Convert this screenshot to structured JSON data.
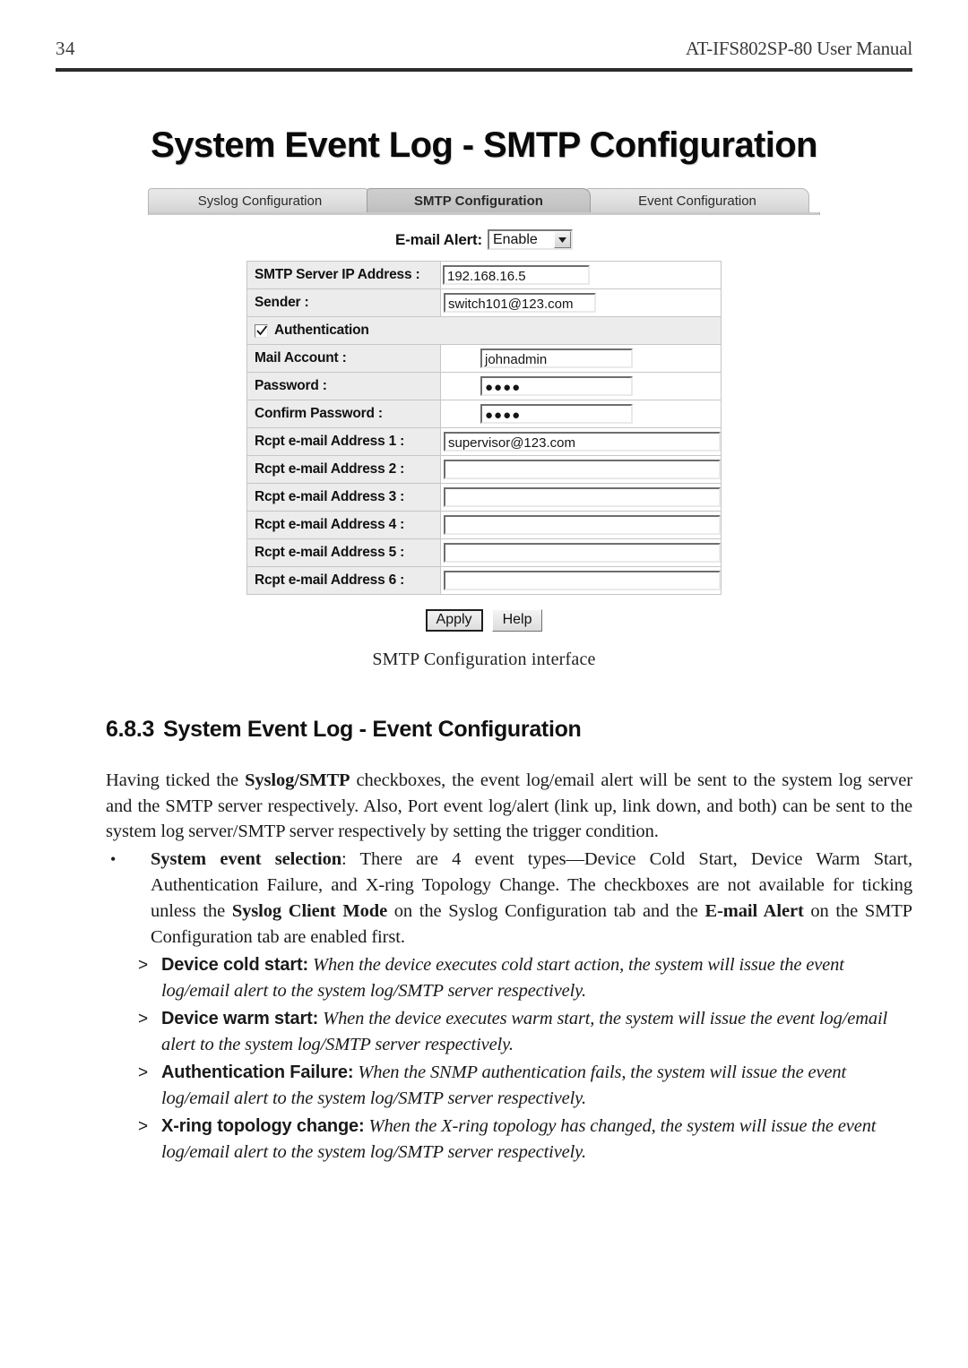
{
  "header": {
    "page_number": "34",
    "manual_title": "AT-IFS802SP-80 User Manual"
  },
  "figure": {
    "title": "System Event Log - SMTP Configuration",
    "tabs": [
      {
        "label": "Syslog Configuration",
        "active": false
      },
      {
        "label": "SMTP Configuration",
        "active": true
      },
      {
        "label": "Event Configuration",
        "active": false
      }
    ],
    "email_alert": {
      "label": "E-mail Alert:",
      "value": "Enable",
      "arrow_icon": "chevron-down-icon"
    },
    "fields": {
      "smtp_server_label": "SMTP Server IP Address :",
      "smtp_server_value": "192.168.16.5",
      "sender_label": "Sender :",
      "sender_value": "switch101@123.com",
      "authentication_label": "Authentication",
      "authentication_checked": true,
      "mail_account_label": "Mail Account :",
      "mail_account_value": "johnadmin",
      "password_label": "Password :",
      "password_value": "●●●●",
      "confirm_password_label": "Confirm Password :",
      "confirm_password_value": "●●●●",
      "rcpt": [
        {
          "label": "Rcpt e-mail Address 1 :",
          "value": "supervisor@123.com"
        },
        {
          "label": "Rcpt e-mail Address 2 :",
          "value": ""
        },
        {
          "label": "Rcpt e-mail Address 3 :",
          "value": ""
        },
        {
          "label": "Rcpt e-mail Address 4 :",
          "value": ""
        },
        {
          "label": "Rcpt e-mail Address 5 :",
          "value": ""
        },
        {
          "label": "Rcpt e-mail Address 6 :",
          "value": ""
        }
      ]
    },
    "buttons": {
      "apply": "Apply",
      "help": "Help"
    },
    "caption": "SMTP Configuration interface"
  },
  "content": {
    "section_number": "6.8.3",
    "section_title": "System Event Log - Event Configuration",
    "paragraph_1_pre": "Having ticked the ",
    "paragraph_1_bold": "Syslog/SMTP",
    "paragraph_1_post": " checkboxes, the event log/email alert will be sent to the system log server and the SMTP server respectively. Also, Port event log/alert (link up, link down, and both) can be sent to the system log server/SMTP server respectively by setting the trigger condition.",
    "bullet": {
      "term": "System event selection",
      "text_1": ": There are 4 event types—Device Cold Start, Device Warm Start, Authentication Failure, and X-ring Topology Change. The checkboxes are not available for ticking unless the ",
      "bold_1": "Syslog Client Mode",
      "text_2": " on the Syslog Configuration tab and the ",
      "bold_2": "E-mail Alert",
      "text_3": " on the SMTP Configuration tab are enabled first."
    },
    "sub_items": [
      {
        "term": "Device cold start",
        "separator": ":",
        "desc": "When the device executes cold start action, the system will issue the event log/email alert to the system log/SMTP server respectively."
      },
      {
        "term": "Device warm start",
        "separator": ":",
        "desc": "When the device executes warm start, the system will issue the event log/email alert to the system log/SMTP server respectively."
      },
      {
        "term": "Authentication Failure",
        "separator": ":",
        "desc": "When the SNMP authentication fails, the system will issue the event log/email alert to the system log/SMTP server respectively."
      },
      {
        "term": "X-ring topology change",
        "separator": ":",
        "desc": "When the X-ring topology has changed, the system will issue the event log/email alert to the system log/SMTP server respectively."
      }
    ]
  }
}
